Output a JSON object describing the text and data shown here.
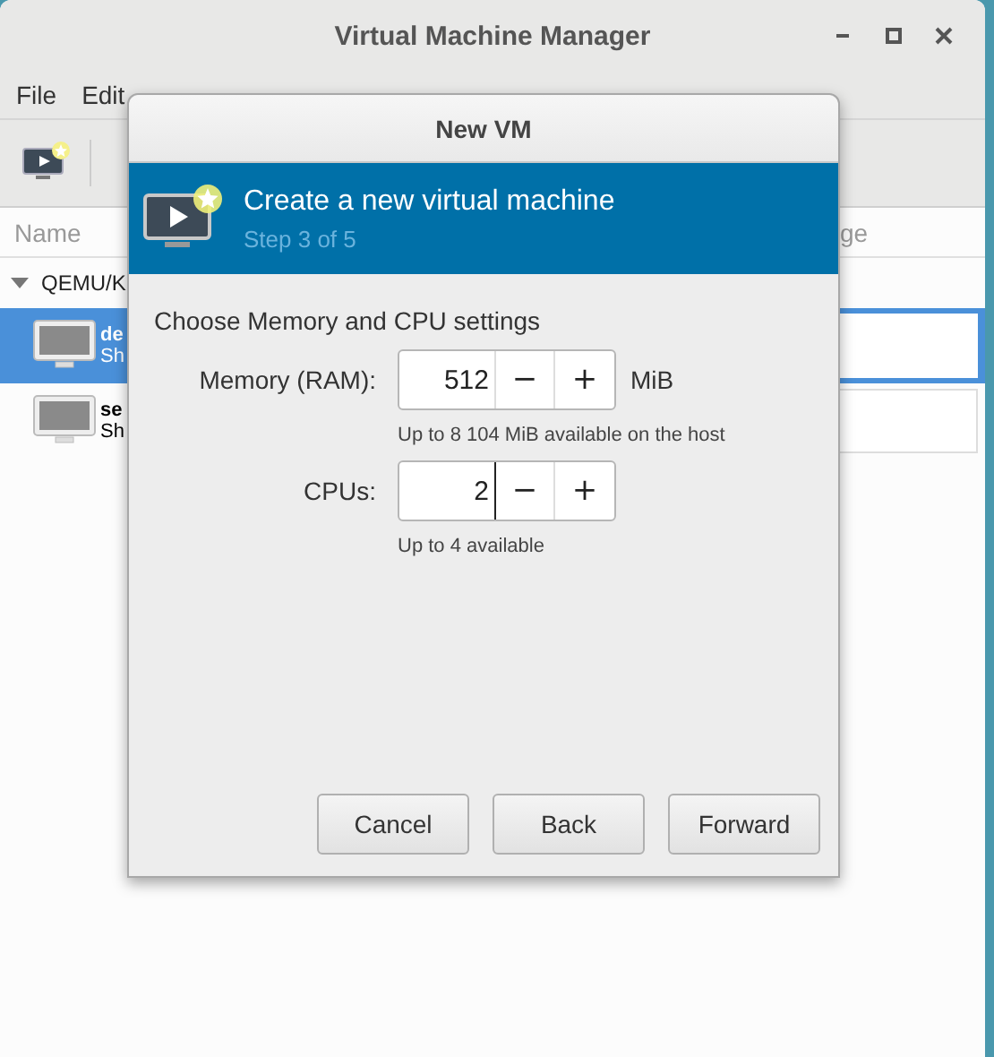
{
  "window": {
    "title": "Virtual Machine Manager"
  },
  "menu": [
    "File",
    "Edit"
  ],
  "columns": [
    "Name",
    "ge"
  ],
  "tree": {
    "label": "QEMU/K",
    "expanded": true,
    "children": [
      {
        "title": "de",
        "subtitle": "Sh",
        "selected": true
      },
      {
        "title": "se",
        "subtitle": "Sh",
        "selected": false
      }
    ]
  },
  "dialog": {
    "title": "New VM",
    "header": {
      "title": "Create a new virtual machine",
      "step": "Step 3 of 5"
    },
    "section": "Choose Memory and CPU settings",
    "fields": [
      {
        "label": "Memory (RAM):",
        "value": "512",
        "unit": "MiB",
        "hint": "Up to 8 104 MiB available on the host",
        "focused": false,
        "minus": "−",
        "plus": "+"
      },
      {
        "label": "CPUs:",
        "value": "2",
        "hint": "Up to 4 available",
        "focused": true,
        "minus": "−",
        "plus": "+"
      }
    ],
    "buttons": [
      "Cancel",
      "Back",
      "Forward"
    ]
  }
}
